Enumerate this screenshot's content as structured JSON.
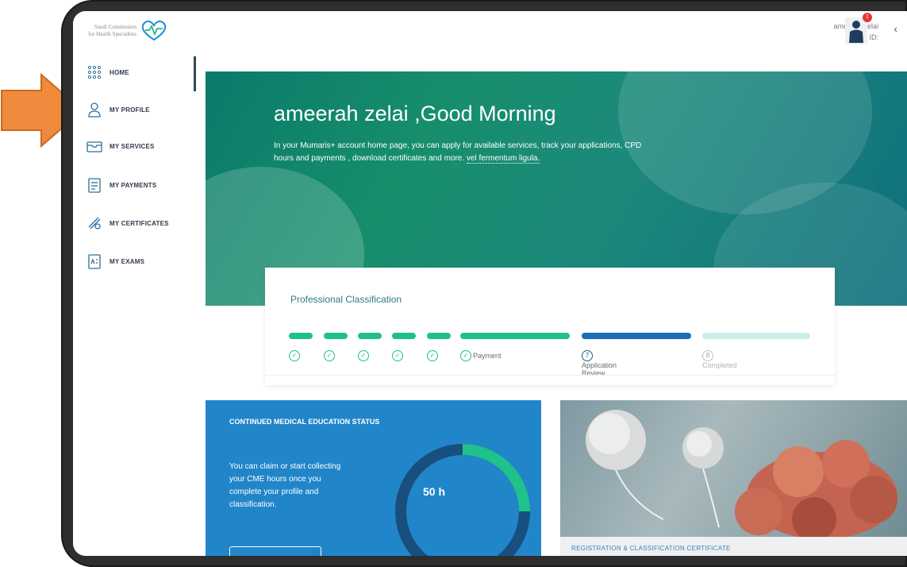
{
  "app": {
    "logo_line1": "Saudi Commission",
    "logo_line2": "for Health Specialties"
  },
  "user": {
    "name": "ameerah zelai",
    "profile_id_label": "Profile ID:",
    "notification_count": "1"
  },
  "sidebar": {
    "items": [
      {
        "label": "HOME",
        "icon": "grid-icon"
      },
      {
        "label": "MY PROFILE",
        "icon": "user-icon"
      },
      {
        "label": "MY SERVICES",
        "icon": "tray-icon"
      },
      {
        "label": "MY PAYMENTS",
        "icon": "clipboard-icon"
      },
      {
        "label": "MY CERTIFICATES",
        "icon": "certificate-icon"
      },
      {
        "label": "MY EXAMS",
        "icon": "exam-icon"
      }
    ]
  },
  "hero": {
    "title": "ameerah zelai ,Good Morning",
    "text": "In your Mumaris+ account home page, you can apply for available services, track your applications, CPD hours and payments , download certificates and more.",
    "link_text": "vel fermentum ligula."
  },
  "classification": {
    "title": "Professional Classification",
    "steps": [
      {
        "label": "",
        "status": "done"
      },
      {
        "label": "",
        "status": "done"
      },
      {
        "label": "",
        "status": "done"
      },
      {
        "label": "",
        "status": "done"
      },
      {
        "label": "",
        "status": "done"
      },
      {
        "label": "Payment",
        "status": "done"
      },
      {
        "label": "Application Review",
        "status": "current",
        "number": "7"
      },
      {
        "label": "Completed",
        "status": "pending",
        "number": "8"
      }
    ]
  },
  "cme": {
    "title": "CONTINUED MEDICAL EDUCATION STATUS",
    "text": "You can claim or start collecting your CME hours once you complete your profile and classification.",
    "hours": "50 h",
    "progress_fraction": 0.25
  },
  "certificate": {
    "label": "REGISTRATION & CLASSIFICATION CERTIFICATE"
  },
  "colors": {
    "accent_green": "#20c08c",
    "accent_blue": "#1a6fb5",
    "step_pending": "#c8eeea",
    "cme_bg": "#2185c9"
  }
}
